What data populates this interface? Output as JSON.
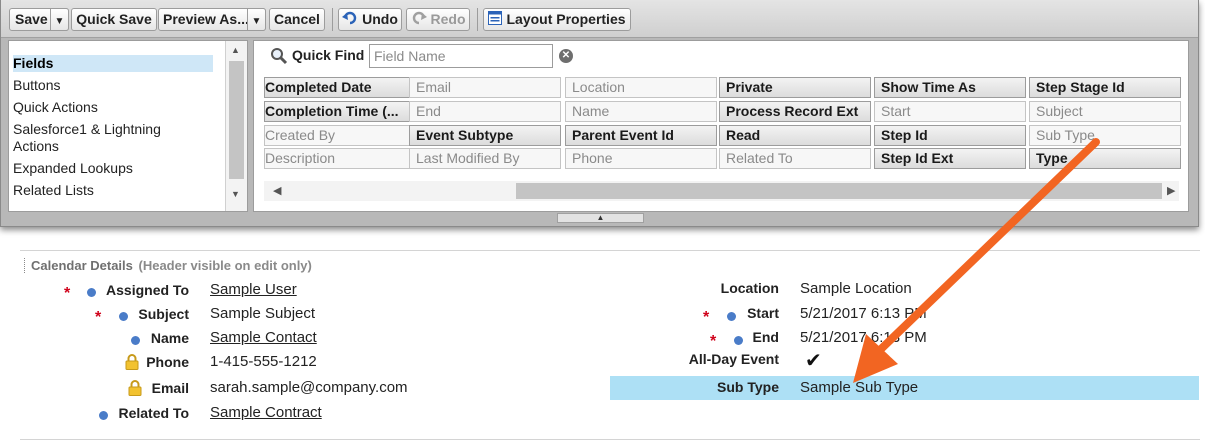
{
  "toolbar": {
    "save": "Save",
    "quick_save": "Quick Save",
    "preview_as": "Preview As...",
    "cancel": "Cancel",
    "undo": "Undo",
    "redo": "Redo",
    "layout_properties": "Layout Properties"
  },
  "categories": {
    "items": [
      "Fields",
      "Buttons",
      "Quick Actions",
      "Salesforce1 & Lightning",
      "Actions",
      "Expanded Lookups",
      "Related Lists"
    ],
    "selected": "Fields"
  },
  "quick_find": {
    "label": "Quick Find",
    "placeholder": "Field Name"
  },
  "fields": {
    "rows": [
      [
        {
          "label": "Completed Date",
          "used": false
        },
        {
          "label": "Email",
          "used": true
        },
        {
          "label": "Location",
          "used": true
        },
        {
          "label": "Private",
          "used": false
        },
        {
          "label": "Show Time As",
          "used": false
        },
        {
          "label": "Step Stage Id",
          "used": false
        }
      ],
      [
        {
          "label": "Completion Time (...",
          "used": false
        },
        {
          "label": "End",
          "used": true
        },
        {
          "label": "Name",
          "used": true
        },
        {
          "label": "Process Record Ext",
          "used": false
        },
        {
          "label": "Start",
          "used": true
        },
        {
          "label": "Subject",
          "used": true
        }
      ],
      [
        {
          "label": "Created By",
          "used": true
        },
        {
          "label": "Event Subtype",
          "used": false
        },
        {
          "label": "Parent Event Id",
          "used": false
        },
        {
          "label": "Read",
          "used": false
        },
        {
          "label": "Step Id",
          "used": false
        },
        {
          "label": "Sub Type",
          "used": true
        }
      ],
      [
        {
          "label": "Description",
          "used": true
        },
        {
          "label": "Last Modified By",
          "used": true
        },
        {
          "label": "Phone",
          "used": true
        },
        {
          "label": "Related To",
          "used": true
        },
        {
          "label": "Step Id Ext",
          "used": false
        },
        {
          "label": "Type",
          "used": false
        }
      ]
    ]
  },
  "section": {
    "title": "Calendar Details",
    "subtitle": "(Header visible on edit only)"
  },
  "left_fields": [
    {
      "label": "Assigned To",
      "value": "Sample User",
      "required": true,
      "indicator": "dot",
      "link": true
    },
    {
      "label": "Subject",
      "value": "Sample Subject",
      "required": true,
      "indicator": "dot",
      "link": false
    },
    {
      "label": "Name",
      "value": "Sample Contact",
      "required": false,
      "indicator": "dot",
      "link": true
    },
    {
      "label": "Phone",
      "value": "1-415-555-1212",
      "required": false,
      "indicator": "lock",
      "link": false
    },
    {
      "label": "Email",
      "value": "sarah.sample@company.com",
      "required": false,
      "indicator": "lock",
      "link": false
    },
    {
      "label": "Related To",
      "value": "Sample Contract",
      "required": false,
      "indicator": "dot",
      "link": true
    }
  ],
  "right_fields": [
    {
      "label": "Location",
      "value": "Sample Location",
      "required": false,
      "indicator": "none"
    },
    {
      "label": "Start",
      "value": "5/21/2017 6:13 PM",
      "required": true,
      "indicator": "dot"
    },
    {
      "label": "End",
      "value": "5/21/2017 6:13 PM",
      "required": true,
      "indicator": "dot"
    },
    {
      "label": "All-Day Event",
      "value": "",
      "checked": true,
      "required": false,
      "indicator": "none"
    },
    {
      "label": "Sub Type",
      "value": "Sample Sub Type",
      "required": false,
      "indicator": "none",
      "highlighted": true
    }
  ],
  "colors": {
    "highlight": "#ade0f5",
    "arrow": "#f26522",
    "required": "#d0021b",
    "indicator_dot": "#4a7cc8"
  },
  "icons": {
    "undo": "undo-icon",
    "redo": "redo-icon",
    "layout_properties": "layout-properties-icon",
    "quick_find": "magnifier-icon",
    "clear": "clear-icon",
    "lock": "lock-icon"
  }
}
